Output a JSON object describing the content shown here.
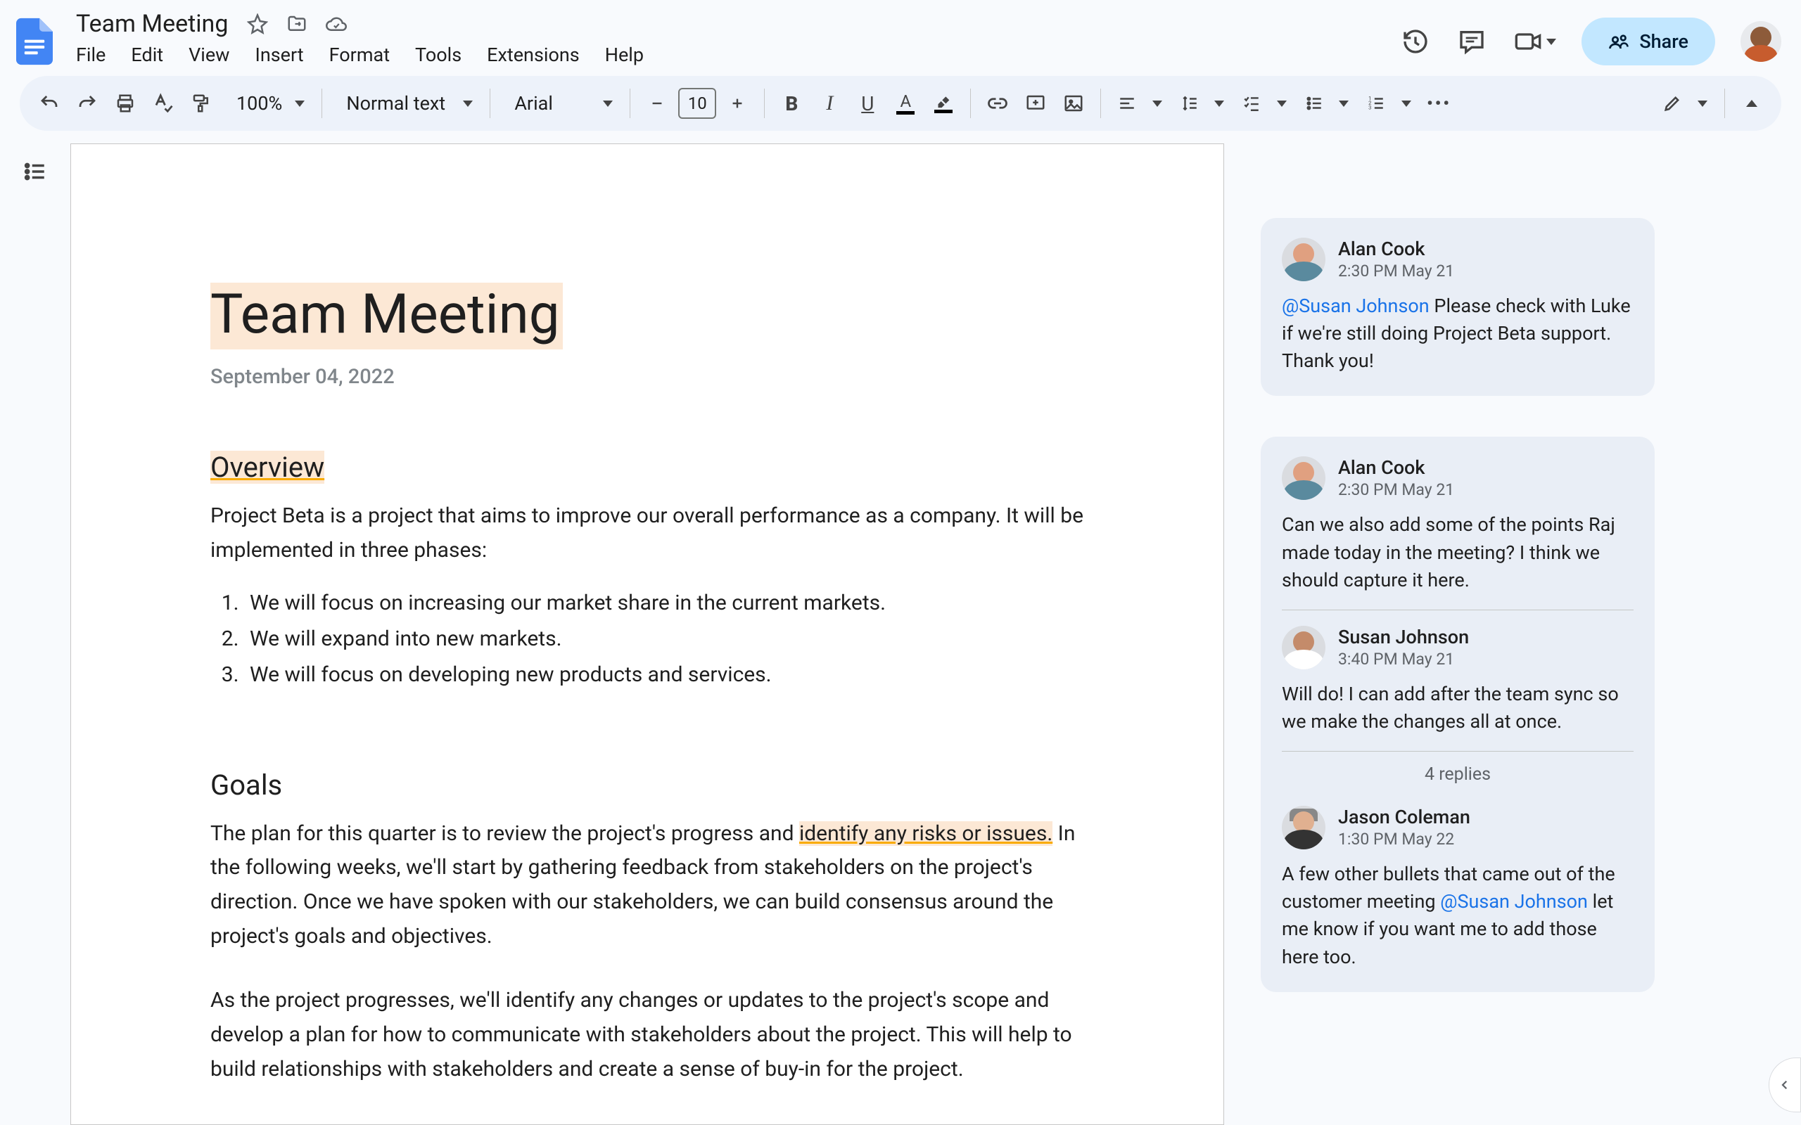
{
  "doc": {
    "title": "Team Meeting",
    "menus": [
      "File",
      "Edit",
      "View",
      "Insert",
      "Format",
      "Tools",
      "Extensions",
      "Help"
    ]
  },
  "toolbar": {
    "zoom": "100%",
    "style": "Normal text",
    "font": "Arial",
    "fontSize": "10"
  },
  "share": {
    "label": "Share"
  },
  "document": {
    "heading": "Team Meeting",
    "date": "September 04, 2022",
    "overview_title": "Overview",
    "overview_p": "Project Beta is a project that aims to improve our overall performance as a company. It will be implemented in three phases:",
    "phases": [
      "We will focus on increasing our market share in the current markets.",
      "We will expand into new markets.",
      "We will focus on developing new products and services."
    ],
    "goals_title": "Goals",
    "goals_p1_a": "The plan for this quarter is to review the project's progress and ",
    "goals_p1_hl": "identify any risks or issues.",
    "goals_p1_b": " In the following weeks, we'll start by gathering feedback from stakeholders on the project's direction. Once we have spoken with our stakeholders, we can build consensus around the project's goals and objectives.",
    "goals_p2": "As the project progresses, we'll identify any changes or updates to the project's scope and develop a plan for how to communicate with stakeholders about the project. This will help to build relationships with stakeholders and create a sense of buy-in for the project."
  },
  "comments": {
    "c1": {
      "author": "Alan Cook",
      "time": "2:30 PM May 21",
      "mention": "@Susan Johnson",
      "body": " Please check with Luke if we're still doing Project Beta support. Thank you!"
    },
    "thread": {
      "t1": {
        "author": "Alan Cook",
        "time": "2:30 PM May 21",
        "body": "Can we also add some of the points Raj made today in the meeting? I think we should capture it here."
      },
      "t2": {
        "author": "Susan Johnson",
        "time": "3:40 PM May 21",
        "body": "Will do! I can add after the team sync so we make the changes all at once."
      },
      "replies": "4 replies",
      "t3": {
        "author": "Jason Coleman",
        "time": "1:30 PM May 22",
        "body_a": "A few other bullets that came out of the customer meeting ",
        "mention": "@Susan Johnson",
        "body_b": " let me know if you want me to add those here too."
      }
    }
  }
}
